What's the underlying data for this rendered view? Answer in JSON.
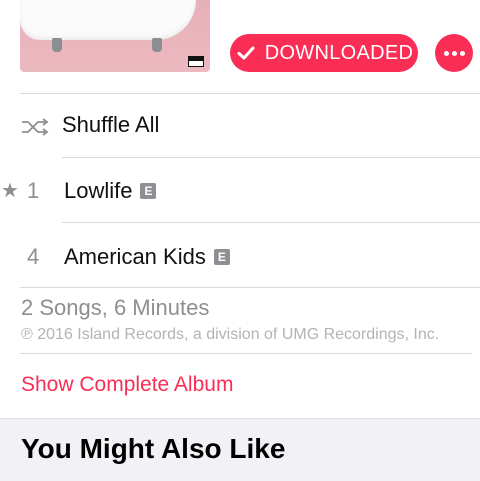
{
  "album": {
    "artwork_icon": "album-artwork",
    "download_label": "DOWNLOADED",
    "download_icon": "checkmark-icon",
    "more_icon": "ellipsis-icon",
    "accent_color": "#fa2d55"
  },
  "shuffle": {
    "icon": "shuffle-icon",
    "label": "Shuffle All"
  },
  "tracks": [
    {
      "number": "1",
      "title": "Lowlife",
      "explicit": "E",
      "popular": "★"
    },
    {
      "number": "4",
      "title": "American Kids",
      "explicit": "E",
      "popular": ""
    }
  ],
  "summary": "2 Songs, 6 Minutes",
  "copyright": "℗ 2016 Island Records, a division of UMG Recordings, Inc.",
  "show_album_label": "Show Complete Album",
  "section_title": "You Might Also Like"
}
